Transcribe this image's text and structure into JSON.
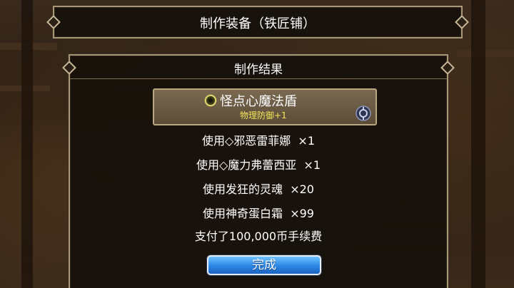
{
  "header": {
    "title": "制作装备（铁匠铺）"
  },
  "result_panel": {
    "title": "制作结果",
    "item": {
      "name": "怪点心魔法盾",
      "stat": "物理防御+1",
      "icon": "ring-icon",
      "badge_icon": "gear-badge-icon"
    },
    "materials": [
      "使用◇邪恶雷菲娜  ×1",
      "使用◇魔力弗蕾西亚  ×1",
      "使用发狂的灵魂  ×20",
      "使用神奇蛋白霜  ×99"
    ],
    "fee": "支付了100,000币手续费",
    "done_button": "完成"
  },
  "colors": {
    "frame_border": "#a89678",
    "item_stat": "#f2e55a",
    "button": "#2a86e6"
  }
}
